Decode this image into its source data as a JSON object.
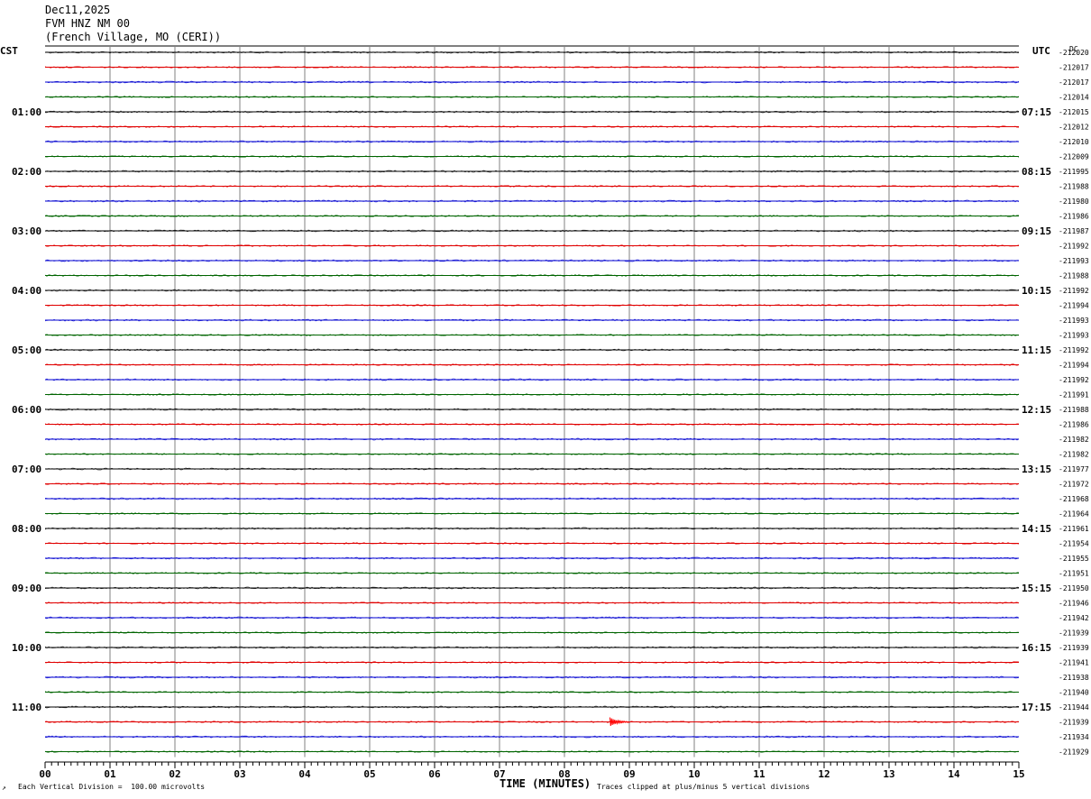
{
  "header": {
    "date": "Dec11,2025",
    "station": "FVM HNZ NM 00",
    "location": "(French Village, MO (CERI))"
  },
  "axes": {
    "left_tz": "CST",
    "right_tz": "UTC",
    "dc_label": "DC",
    "xlabel": "TIME (MINUTES)"
  },
  "footer": {
    "scale_note": "Each Vertical Division =  100.00 microvolts",
    "clip_note": "Traces clipped at plus/minus 5 vertical divisions"
  },
  "colors": {
    "trace_cycle": [
      "#000000",
      "#e00000",
      "#0000d0",
      "#006400"
    ],
    "grid": "#808080",
    "event": "#ff0000"
  },
  "chart_data": {
    "type": "line",
    "xlim": [
      0,
      15
    ],
    "x_ticks": [
      "00",
      "01",
      "02",
      "03",
      "04",
      "05",
      "06",
      "07",
      "08",
      "09",
      "10",
      "11",
      "12",
      "13",
      "14",
      "15"
    ],
    "left_hour_labels": [
      "01:00",
      "02:00",
      "03:00",
      "04:00",
      "05:00",
      "06:00",
      "07:00",
      "08:00",
      "09:00",
      "10:00",
      "11:00"
    ],
    "right_hour_labels": [
      "07:15",
      "08:15",
      "09:15",
      "10:15",
      "11:15",
      "12:15",
      "13:15",
      "14:15",
      "15:15",
      "16:15",
      "17:15"
    ],
    "dc_offsets": [
      "212020",
      "212017",
      "212017",
      "212014",
      "212015",
      "212012",
      "212010",
      "212009",
      "211995",
      "211988",
      "211980",
      "211986",
      "211987",
      "211992",
      "211993",
      "211988",
      "211992",
      "211994",
      "211993",
      "211993",
      "211992",
      "211994",
      "211992",
      "211991",
      "211988",
      "211986",
      "211982",
      "211982",
      "211977",
      "211972",
      "211968",
      "211964",
      "211961",
      "211954",
      "211955",
      "211951",
      "211950",
      "211946",
      "211942",
      "211939",
      "211939",
      "211941",
      "211938",
      "211940",
      "211944",
      "211939",
      "211934",
      "211929"
    ],
    "traces_per_hour": 4,
    "event": {
      "trace_index": 45,
      "minute": 8.7
    }
  }
}
